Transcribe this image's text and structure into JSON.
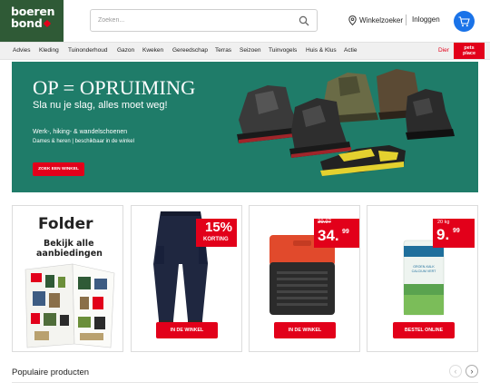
{
  "logo": {
    "line1": "boeren",
    "line2": "bond"
  },
  "search": {
    "placeholder": "Zoeken..."
  },
  "header": {
    "store_label": "Winkelzoeker",
    "login_label": "Inloggen"
  },
  "nav": {
    "items": [
      "Advies",
      "Kleding",
      "Tuinonderhoud",
      "Gazon",
      "Kweken",
      "Gereedschap",
      "Terras",
      "Seizoen",
      "Tuinvogels",
      "Huis & Klus",
      "Actie"
    ],
    "dier": "Dier",
    "pets_place": {
      "line1": "pets",
      "line2": "place"
    }
  },
  "hero": {
    "title": "OP = OPRUIMING",
    "subtitle": "Sla nu je slag, alles moet weg!",
    "line1": "Werk-, hiking- & wandelschoenen",
    "line2": "Dames & heren | beschikbaar in de winkel",
    "button": "ZOEK EEN WINKEL"
  },
  "cards": {
    "folder": {
      "title": "Folder",
      "sub1": "Bekijk alle",
      "sub2": "aanbiedingen"
    },
    "pants": {
      "percent": "15%",
      "label": "KORTING",
      "button": "IN DE WINKEL"
    },
    "heater": {
      "old_price": "39.97",
      "price_main": "34.",
      "price_cents": "99",
      "button": "IN DE WINKEL"
    },
    "lime": {
      "weight": "20 kg",
      "price_main": "9.",
      "price_cents": "99",
      "package_text": "GROEN-KALK CALCIUM VERT",
      "button": "BESTEL ONLINE"
    }
  },
  "popular": {
    "title": "Populaire producten"
  },
  "colors": {
    "brand_green": "#2f5a36",
    "hero_teal": "#1f7c69",
    "promo_red": "#e2001a",
    "cart_blue": "#1a73e8"
  }
}
